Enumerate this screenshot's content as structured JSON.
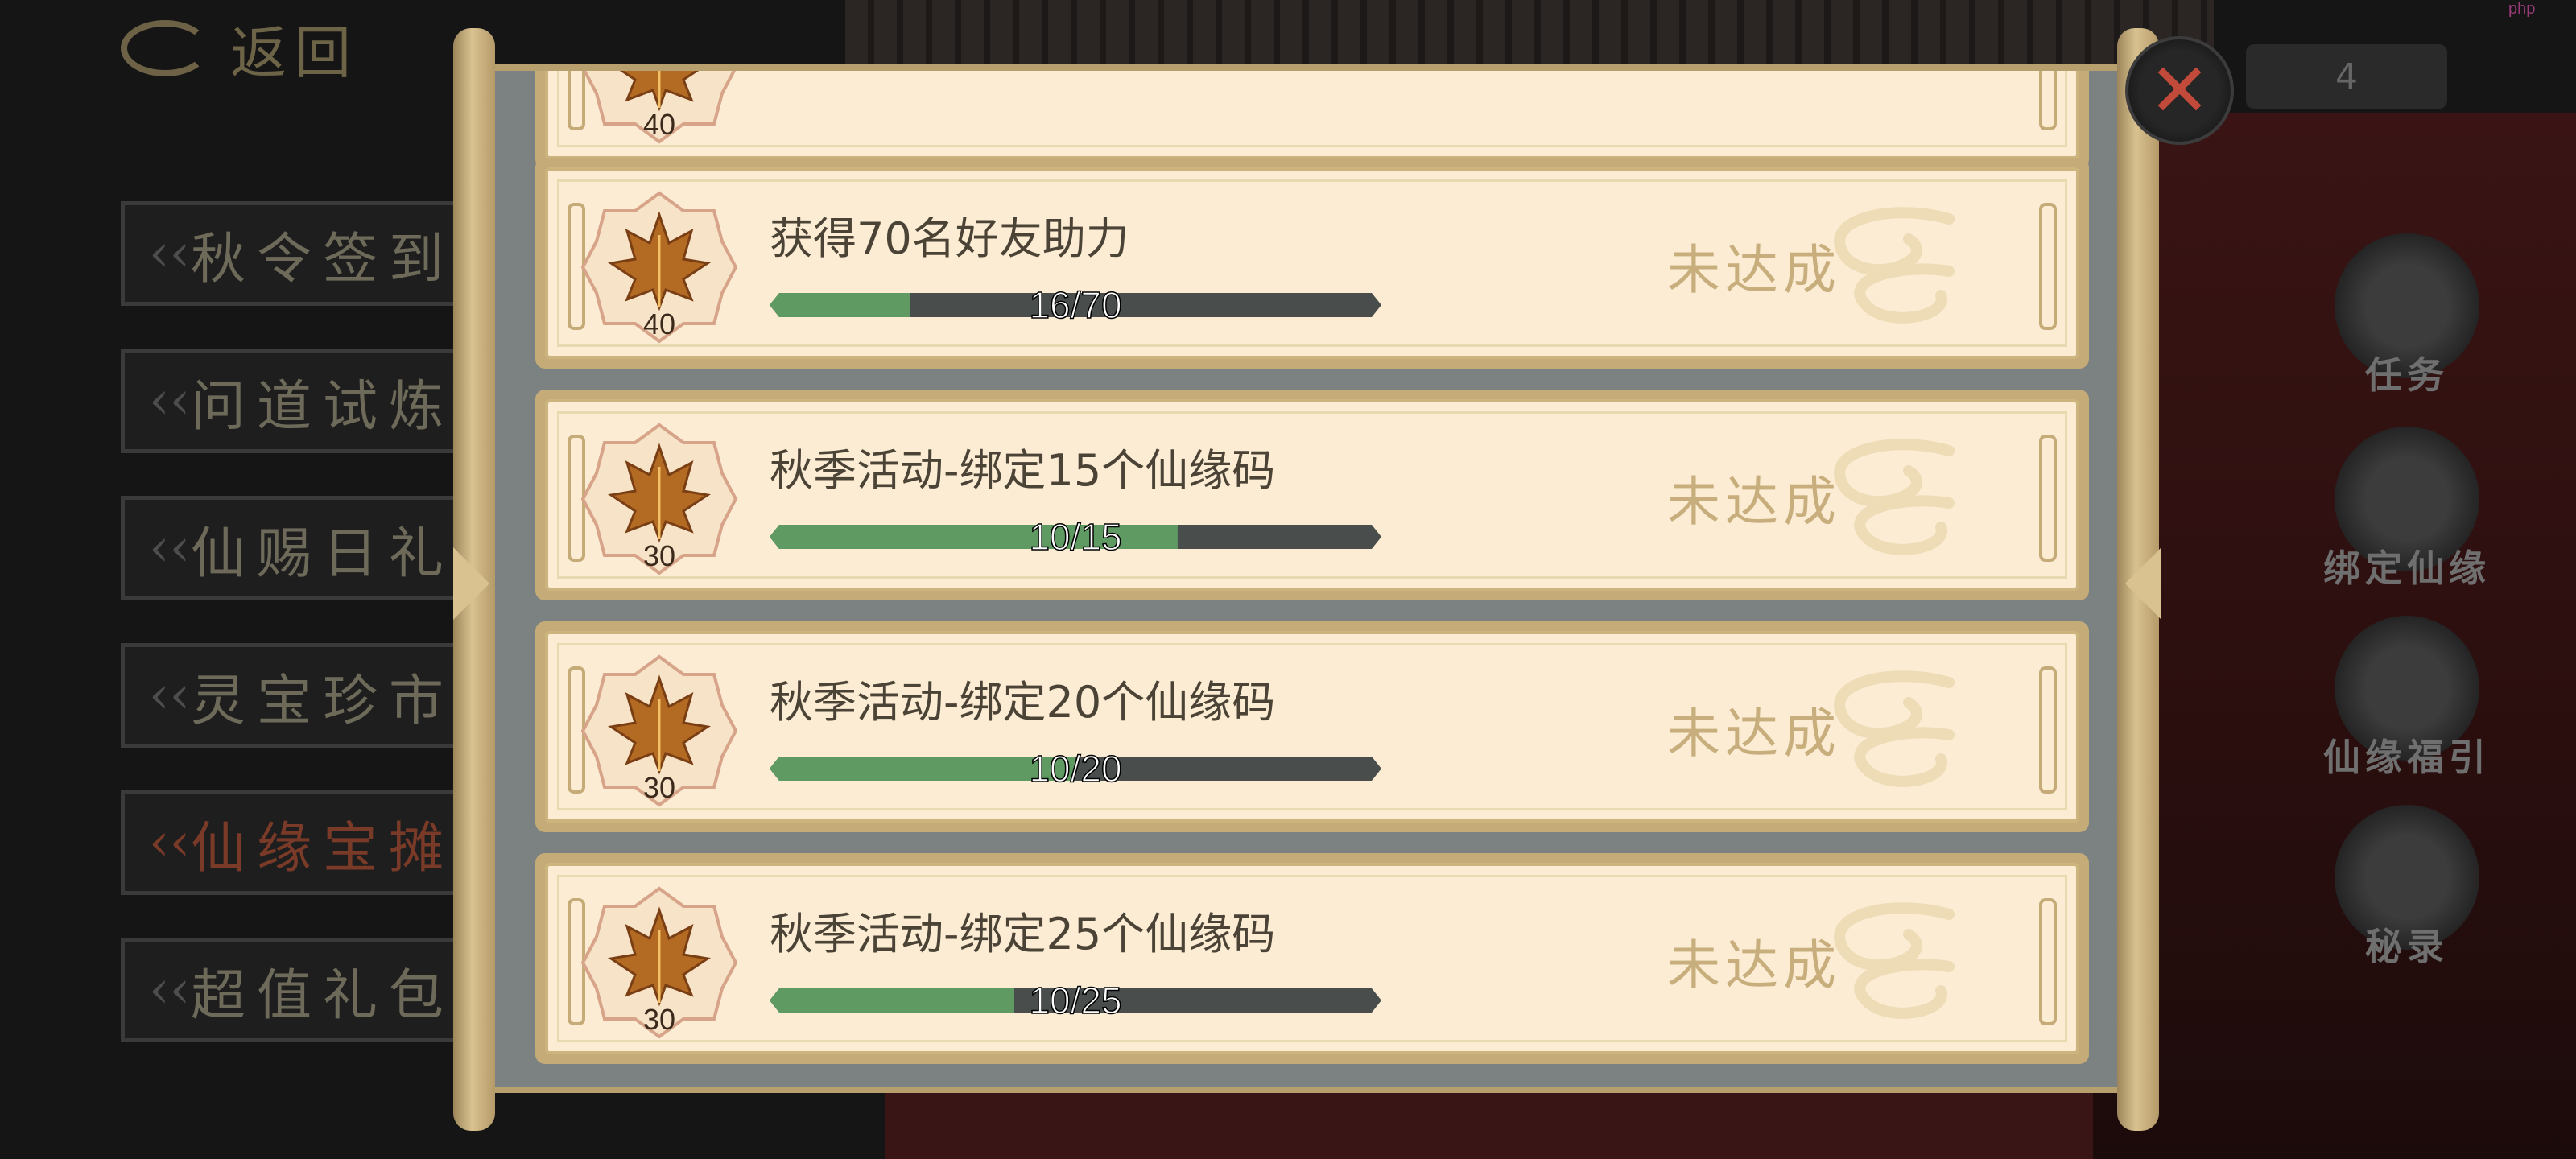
{
  "colors": {
    "accent_gold": "#d9c290",
    "progress_fill": "#5f9a63",
    "progress_track": "#494e4d",
    "card_bg": "#fbecd3",
    "close_icon": "#c24a3a"
  },
  "back": {
    "label": "返回"
  },
  "counter": {
    "value": "4"
  },
  "watermark": "php",
  "menu": [
    {
      "label": "秋令签到"
    },
    {
      "label": "问道试炼"
    },
    {
      "label": "仙赐日礼"
    },
    {
      "label": "灵宝珍市"
    },
    {
      "label": "仙缘宝摊",
      "active": true
    },
    {
      "label": "超值礼包"
    }
  ],
  "right_buttons": [
    {
      "label": "任务",
      "icon": "scroll-icon"
    },
    {
      "label": "绑定仙缘",
      "icon": "bind-icon"
    },
    {
      "label": "仙缘福引",
      "icon": "scroll-roll-icon"
    },
    {
      "label": "秘录",
      "icon": "secret-book-icon"
    }
  ],
  "tasks": [
    {
      "title": "",
      "reward": "40",
      "progress_text": "",
      "progress": 0,
      "status": ""
    },
    {
      "title": "获得70名好友助力",
      "reward": "40",
      "progress_text": "16/70",
      "progress": 0.229,
      "status": "未达成"
    },
    {
      "title": "秋季活动-绑定15个仙缘码",
      "reward": "30",
      "progress_text": "10/15",
      "progress": 0.667,
      "status": "未达成"
    },
    {
      "title": "秋季活动-绑定20个仙缘码",
      "reward": "30",
      "progress_text": "10/20",
      "progress": 0.5,
      "status": "未达成"
    },
    {
      "title": "秋季活动-绑定25个仙缘码",
      "reward": "30",
      "progress_text": "10/25",
      "progress": 0.4,
      "status": "未达成"
    }
  ]
}
